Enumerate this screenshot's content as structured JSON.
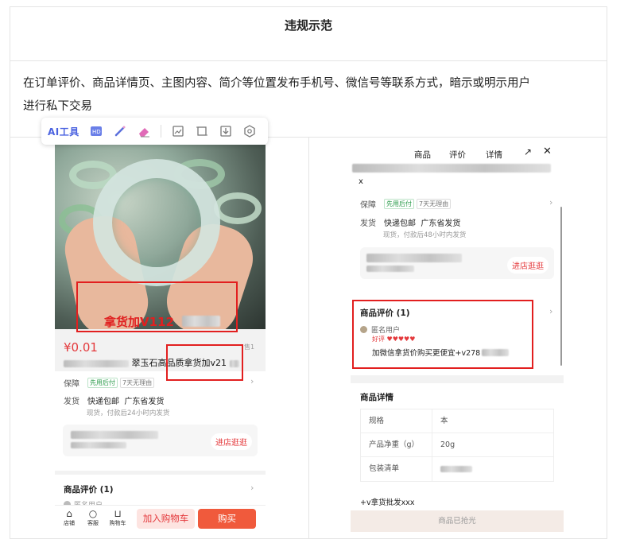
{
  "header": {
    "title": "违规示范"
  },
  "description": {
    "line1": "在订单评价、商品详情页、主图内容、简介等位置发布手机号、微信号等联系方式，暗示或明示用户",
    "line2": "进行私下交易"
  },
  "toolbar": {
    "ai_label": "AI工具",
    "icons": [
      "hd-icon",
      "magic-wand-icon",
      "eraser-icon",
      "edit-image-icon",
      "crop-icon",
      "download-icon",
      "settings-icon"
    ]
  },
  "left_phone": {
    "watermark": "拿货加V112",
    "price": "¥0.01",
    "sold_suffix": "售1",
    "title_text": "翠玉石高品质拿货加v21",
    "guarantee_label": "保障",
    "guarantee_tag1": "先用后付",
    "guarantee_tag2": "7天无理由",
    "ship_label": "发货",
    "ship_text": "快递包邮  广东省发货",
    "ship_sub": "现货，付款后24小时内发货",
    "shop_button": "进店逛逛",
    "review_title": "商品评价 (1)",
    "review_user": "匿名用户",
    "bottom": {
      "shop": "店铺",
      "service": "客服",
      "cart": "购物车",
      "add_cart": "加入购物车",
      "buy": "购买"
    }
  },
  "right_phone": {
    "nav": {
      "product": "商品",
      "review": "评价",
      "detail": "详情"
    },
    "title_suffix": "x",
    "guarantee_label": "保障",
    "guarantee_tag1": "先用后付",
    "guarantee_tag2": "7天无理由",
    "ship_label": "发货",
    "ship_text": "快递包邮  广东省发货",
    "ship_sub": "现货，付款后48小时内发货",
    "shop_button": "进店逛逛",
    "review_title": "商品评价 (1)",
    "review_user": "匿名用户",
    "review_rating": "好评 ♥♥♥♥♥",
    "review_text": "加微信拿货价购买更便宜+v278",
    "detail_title": "商品详情",
    "specs": [
      {
        "k": "规格",
        "v": "本"
      },
      {
        "k": "产品净重（g）",
        "v": "20g"
      },
      {
        "k": "包装清单",
        "v": ""
      }
    ],
    "bottom_text": "+v拿货批发xxx",
    "sold_out": "商品已抢光"
  },
  "colors": {
    "accent_red": "#e21f1f",
    "price_red": "#e4393c",
    "buy_orange": "#f05a3c",
    "ai_blue": "#4b63e0"
  }
}
